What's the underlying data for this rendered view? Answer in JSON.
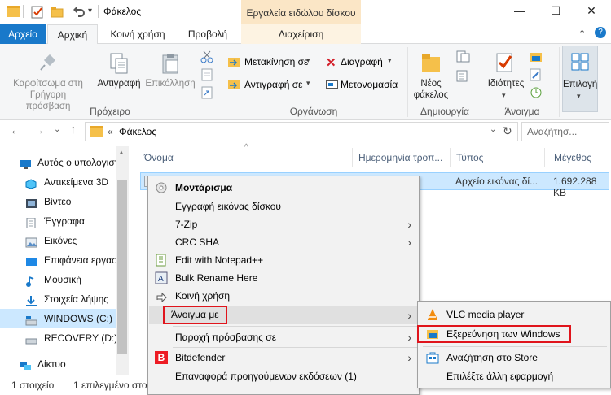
{
  "window": {
    "title": "Φάκελος",
    "tool_tab_header": "Εργαλεία ειδώλου δίσκου",
    "minimize": "—",
    "maximize": "☐",
    "close": "✕"
  },
  "ribbon_tabs": {
    "file": "Αρχείο",
    "home": "Αρχική",
    "share": "Κοινή χρήση",
    "view": "Προβολή",
    "manage": "Διαχείριση"
  },
  "ribbon": {
    "pin_label_1": "Καρφίτσωμα στη",
    "pin_label_2": "Γρήγορη πρόσβαση",
    "copy_label": "Αντιγραφή",
    "paste_label": "Επικόλληση",
    "clipboard_group": "Πρόχειρο",
    "move_to": "Μετακίνηση σε",
    "copy_to": "Αντιγραφή σε",
    "delete": "Διαγραφή",
    "rename": "Μετονομασία",
    "organize_group": "Οργάνωση",
    "new_folder_1": "Νέος",
    "new_folder_2": "φάκελος",
    "new_group": "Δημιουργία",
    "properties": "Ιδιότητες",
    "open_group": "Άνοιγμα",
    "select": "Επιλογή"
  },
  "address": {
    "prefix": "«",
    "path": "Φάκελος",
    "search_placeholder": "Αναζήτησ..."
  },
  "nav": {
    "items": [
      {
        "label": "Αυτός ο υπολογιστής",
        "icon": "computer-icon"
      },
      {
        "label": "Αντικείμενα 3D",
        "icon": "cube-3d-icon"
      },
      {
        "label": "Βίντεο",
        "icon": "video-icon"
      },
      {
        "label": "Έγγραφα",
        "icon": "documents-icon"
      },
      {
        "label": "Εικόνες",
        "icon": "pictures-icon"
      },
      {
        "label": "Επιφάνεια εργασίας",
        "icon": "desktop-icon"
      },
      {
        "label": "Μουσική",
        "icon": "music-icon"
      },
      {
        "label": "Στοιχεία λήψης",
        "icon": "downloads-icon"
      },
      {
        "label": "WINDOWS (C:)",
        "icon": "drive-c-icon"
      },
      {
        "label": "RECOVERY (D:)",
        "icon": "drive-d-icon"
      },
      {
        "label": "Δίκτυο",
        "icon": "network-icon"
      }
    ]
  },
  "columns": {
    "name": "Όνομα",
    "date": "Ημερομηνία τροπ...",
    "type": "Τύπος",
    "size": "Μέγεθος"
  },
  "file": {
    "type": "Αρχείο εικόνας δί...",
    "size": "1.692.288 KB"
  },
  "status": {
    "count": "1 στοιχείο",
    "selected": "1 επιλεγμένο στο"
  },
  "context_menu": {
    "items": [
      {
        "label": "Μοντάρισμα",
        "bold": true
      },
      {
        "label": "Εγγραφή εικόνας δίσκου"
      },
      {
        "label": "7-Zip"
      },
      {
        "label": "CRC SHA"
      },
      {
        "label": "Edit with Notepad++"
      },
      {
        "label": "Bulk Rename Here"
      },
      {
        "label": "Κοινή χρήση"
      },
      {
        "label": "Άνοιγμα με"
      },
      {
        "label": "Παροχή πρόσβασης σε"
      },
      {
        "label": "Bitdefender"
      },
      {
        "label": "Επαναφορά προηγούμενων εκδόσεων (1)"
      }
    ]
  },
  "open_with": {
    "items": [
      {
        "label": "VLC media player"
      },
      {
        "label": "Εξερεύνηση των Windows"
      },
      {
        "label": "Αναζήτηση στο Store"
      },
      {
        "label": "Επιλέξτε άλλη εφαρμογή"
      }
    ]
  },
  "colors": {
    "accent": "#1979ca",
    "highlight_box": "#e0141c",
    "selection": "#cce8ff"
  }
}
